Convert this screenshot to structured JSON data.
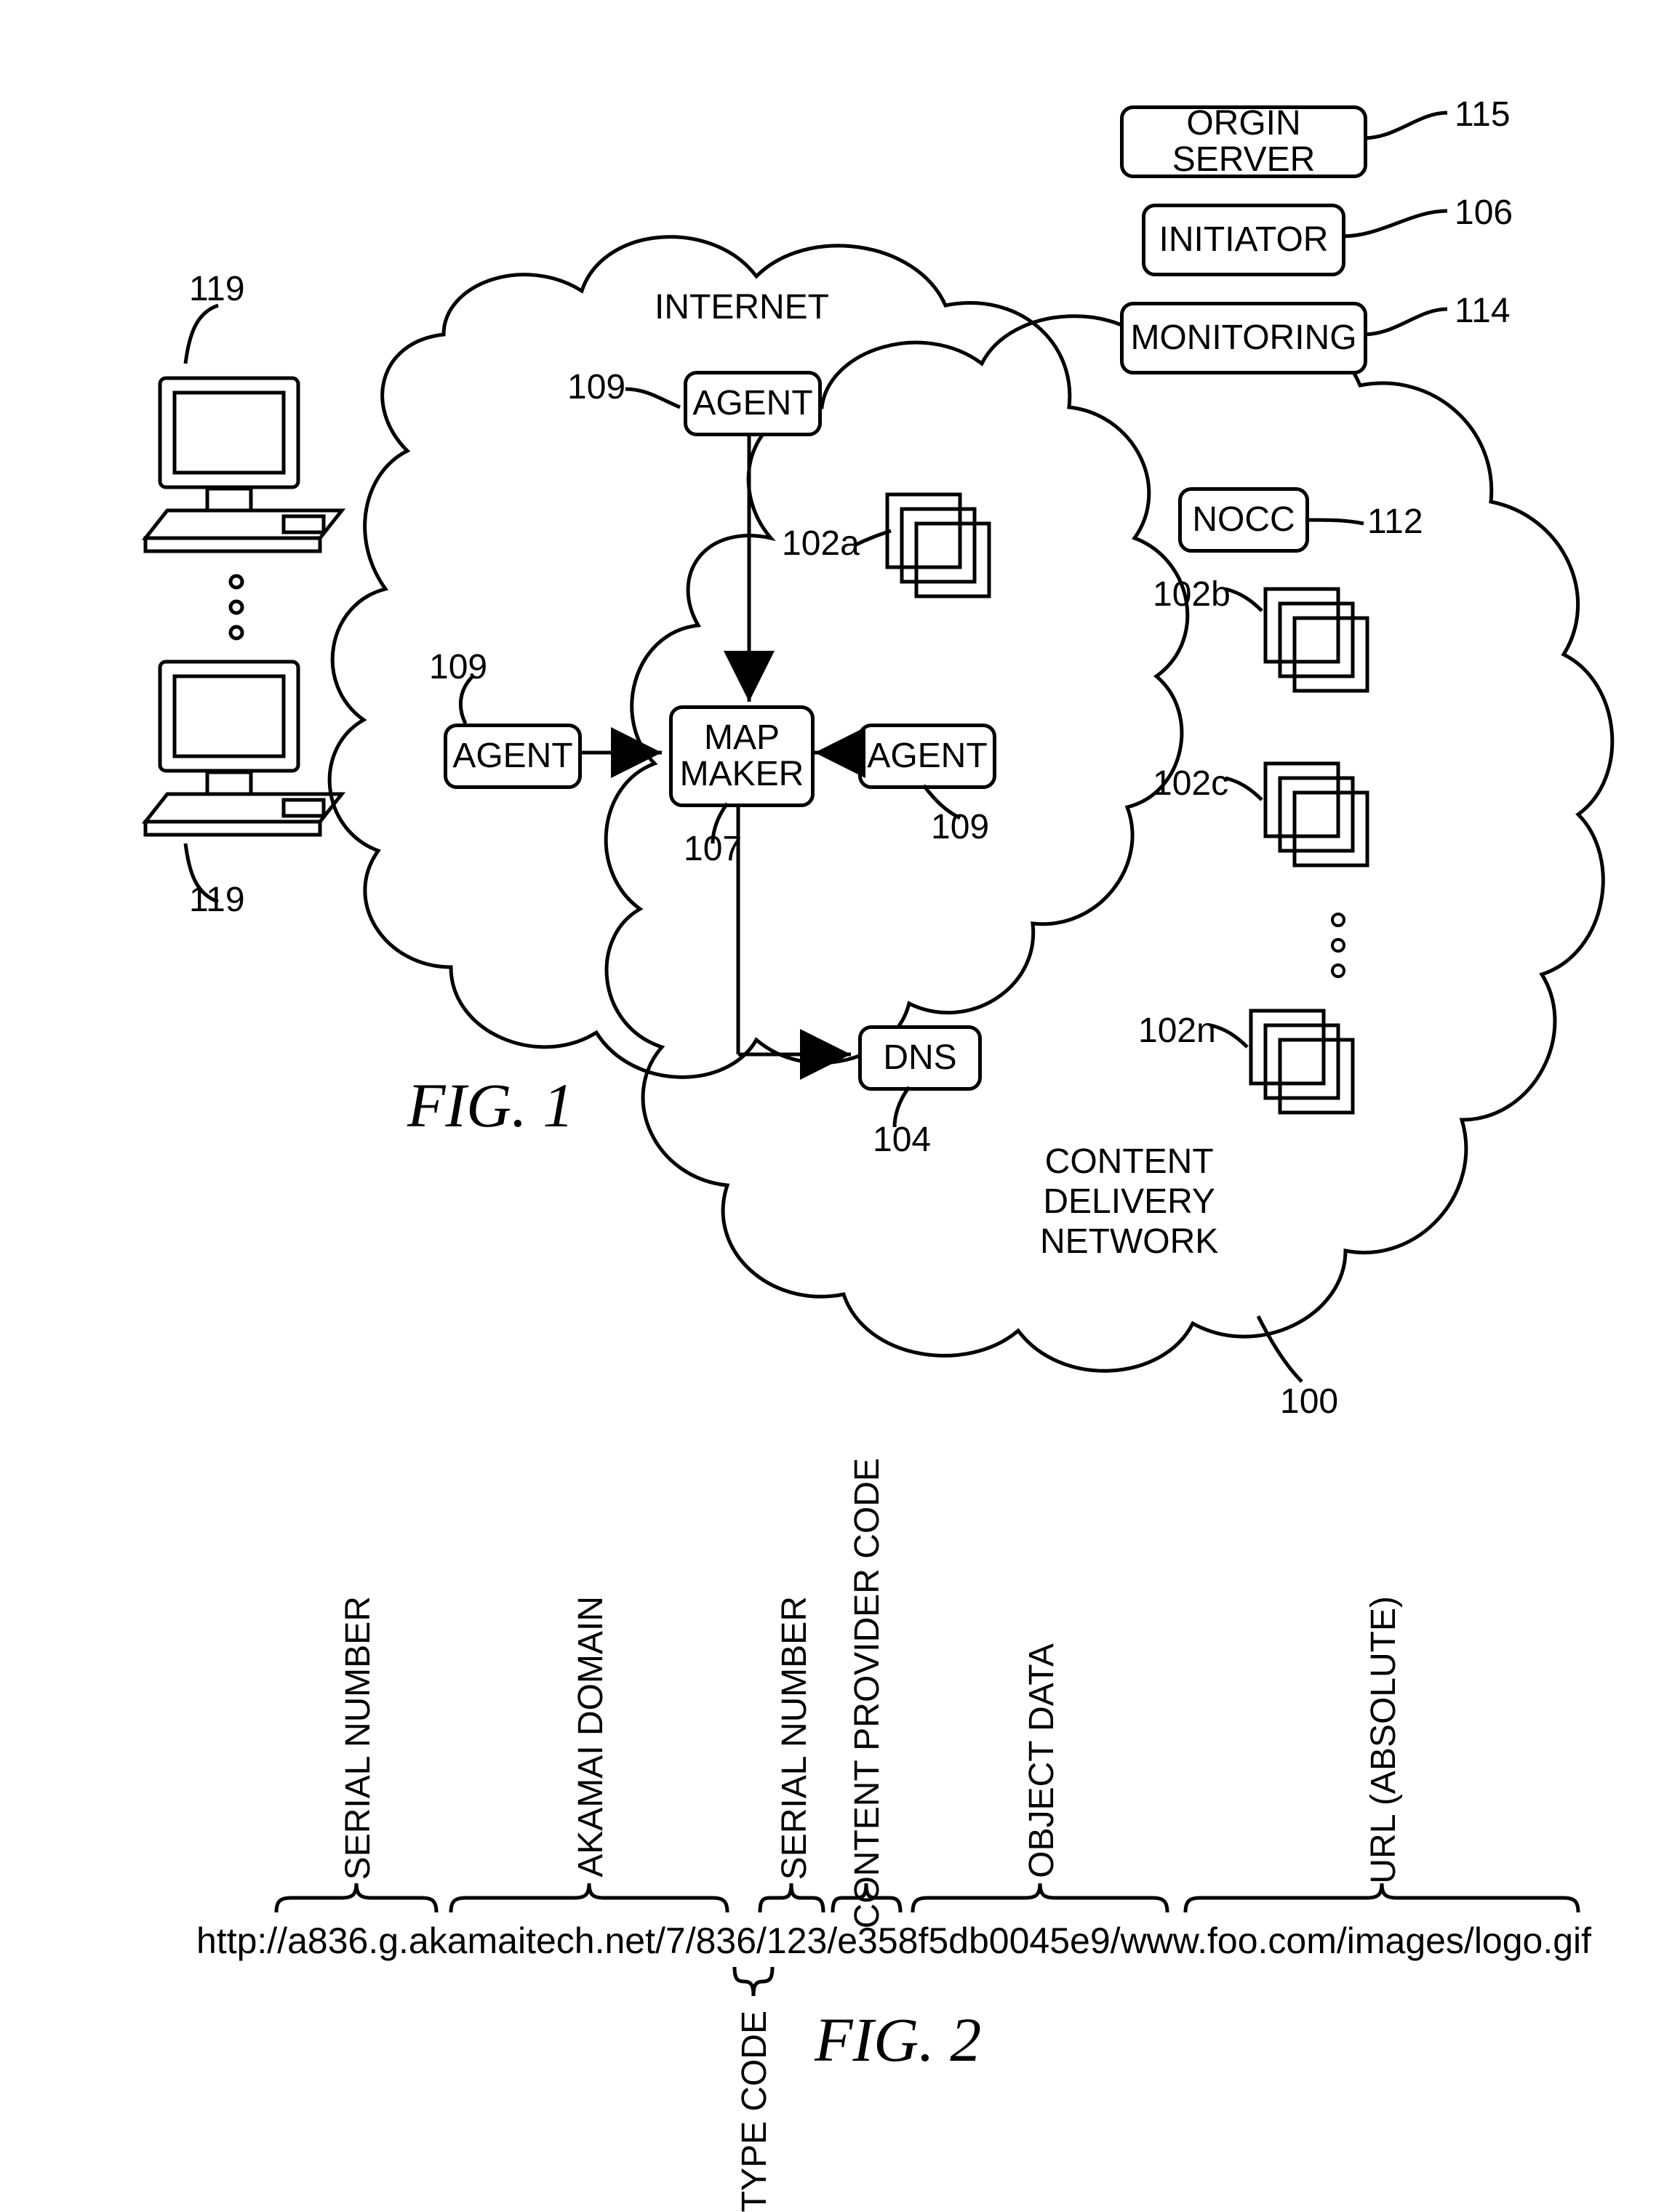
{
  "fig1": {
    "title": "FIG. 1",
    "internet_label": "INTERNET",
    "cdn_label_line1": "CONTENT",
    "cdn_label_line2": "DELIVERY",
    "cdn_label_line3": "NETWORK",
    "boxes": {
      "origin_server": "ORGIN SERVER",
      "initiator": "INITIATOR",
      "monitoring": "MONITORING",
      "agent": "AGENT",
      "map_maker_l1": "MAP",
      "map_maker_l2": "MAKER",
      "dns": "DNS",
      "nocc": "NOCC"
    },
    "refs": {
      "origin_server": "115",
      "initiator": "106",
      "monitoring": "114",
      "client": "119",
      "agent_top": "109",
      "agent_left": "109",
      "agent_right": "109",
      "map_maker": "107",
      "dns": "104",
      "nocc": "112",
      "stack_a": "102a",
      "stack_b": "102b",
      "stack_c": "102c",
      "stack_n": "102n",
      "cdn": "100"
    }
  },
  "fig2": {
    "title": "FIG. 2",
    "url_parts": {
      "p1": "http://a836",
      "p2": ".g.akamaitech.net/",
      "p3": "7",
      "p4": "/836",
      "p5": "/123",
      "p6": "/e358f5db0045e9/",
      "p7": "www.foo.com/images/logo.gif"
    },
    "labels": {
      "serial1": "SERIAL NUMBER",
      "domain": "AKAMAI DOMAIN",
      "type": "TYPE CODE",
      "serial2": "SERIAL NUMBER",
      "provider": "CONTENT PROVIDER CODE",
      "object": "OBJECT DATA",
      "url_abs": "URL (ABSOLUTE)"
    }
  }
}
